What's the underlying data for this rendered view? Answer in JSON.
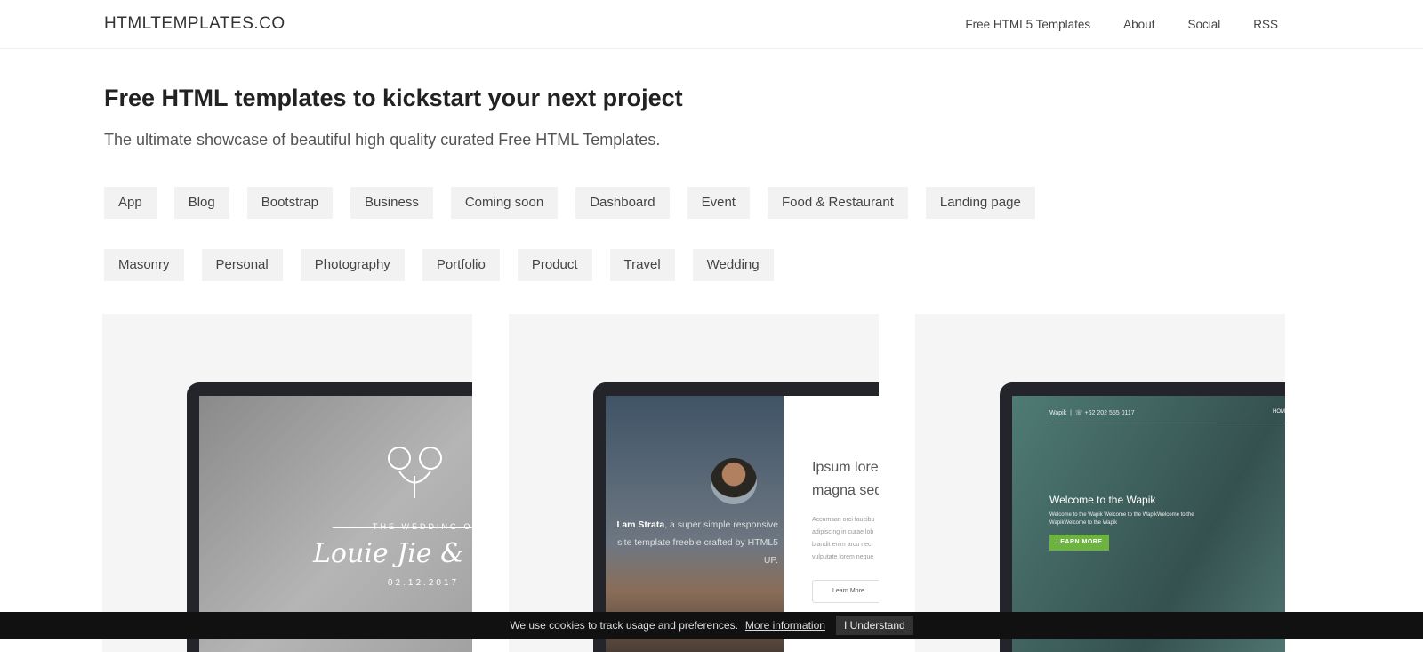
{
  "nav": {
    "logo": "HTMLTEMPLATES.CO",
    "links": [
      "Free HTML5 Templates",
      "About",
      "Social",
      "RSS"
    ]
  },
  "hero": {
    "title": "Free HTML templates to kickstart your next project",
    "subtitle": "The ultimate showcase of beautiful high quality curated Free HTML Templates."
  },
  "tags": [
    "App",
    "Blog",
    "Bootstrap",
    "Business",
    "Coming soon",
    "Dashboard",
    "Event",
    "Food & Restaurant",
    "Landing page",
    "Masonry",
    "Personal",
    "Photography",
    "Portfolio",
    "Product",
    "Travel",
    "Wedding"
  ],
  "cards": {
    "wedding": {
      "label": "THE WEDDING OF",
      "names": "Louie Jie & Mar",
      "date": "02.12.2017"
    },
    "strata": {
      "intro_bold": "I am Strata",
      "intro_rest": ", a super simple responsive site template freebie crafted by HTML5 UP.",
      "heading": "Ipsum lore magna sed",
      "body": "Accumsan orci faucibu adipiscing in curae lob blandit enim arcu nec vulputate lorem neque",
      "button": "Learn More"
    },
    "wapik": {
      "brand": "Wapik",
      "phone": "+62 202 555 0117",
      "nav": "HOM",
      "title": "Welcome to the Wapik",
      "text": "Welcome to the Wapik Welcome to the WapikWelcome to the WapikWelcome to the Wapik",
      "button": "LEARN MORE",
      "accent": "#6db33f"
    }
  },
  "cookie": {
    "text": "We use cookies to track usage and preferences.",
    "link": "More information",
    "button": "I Understand"
  }
}
